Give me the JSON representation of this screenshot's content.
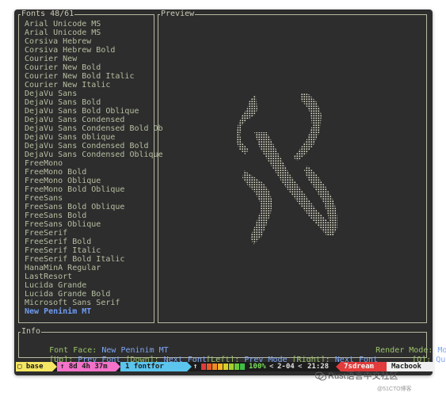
{
  "fonts_panel": {
    "title": "Fonts 48/61",
    "items": [
      "Arial Unicode MS",
      "Arial Unicode MS",
      "Corsiva Hebrew",
      "Corsiva Hebrew Bold",
      "Courier New",
      "Courier New Bold",
      "Courier New Bold Italic",
      "Courier New Italic",
      "DejaVu Sans",
      "DejaVu Sans Bold",
      "DejaVu Sans Bold Oblique",
      "DejaVu Sans Condensed",
      "DejaVu Sans Condensed Bold Ob",
      "DejaVu Sans Oblique",
      "DejaVu Sans Condensed Bold",
      "DejaVu Sans Condensed Oblique",
      "FreeMono",
      "FreeMono Bold",
      "FreeMono Oblique",
      "FreeMono Bold Oblique",
      "FreeSans",
      "FreeSans Bold Oblique",
      "FreeSans Bold",
      "FreeSans Oblique",
      "FreeSerif",
      "FreeSerif Bold",
      "FreeSerif Italic",
      "FreeSerif Bold Italic",
      "HanaMinA Regular",
      "LastResort",
      "Lucida Grande",
      "Lucida Grande Bold",
      "Microsoft Sans Serif",
      "New Peninim MT"
    ],
    "selected_index": 33
  },
  "preview_panel": {
    "title": "Preview"
  },
  "info_panel": {
    "title": "Info",
    "font_face_label": "Font Face:",
    "font_face_value": "New Peninim MT",
    "render_mode_label": "Render Mode:",
    "render_mode_value": "Mono",
    "key_up": "[Up]:",
    "action_prev_font": "Prev Font",
    "key_down": "[Down]:",
    "action_next_font": "Next Font",
    "key_left": "[Left]:",
    "action_prev_mode": "Prev Mode",
    "key_right": "[Right]:",
    "action_next_mode": "Next Font",
    "key_quit": "[Q]:",
    "action_quit": "Quit"
  },
  "status_bar": {
    "mode": "base",
    "time_up": "↑ 8d 4h 37m",
    "window": "1 fontfor",
    "arrow": "↑",
    "battery": "100%",
    "pane": "2-04",
    "clock": "21:28",
    "session": "7sdream",
    "host": "Macbook"
  },
  "watermark": {
    "text": "Rust语言中文社区",
    "sub": "@51CTO博客"
  },
  "colors": {
    "background": "#2d2d2d",
    "list_text": "#b6bfa1",
    "selected": "#6f9cf2",
    "info_green": "#9bc36b",
    "info_blue": "#7fa7f5"
  }
}
